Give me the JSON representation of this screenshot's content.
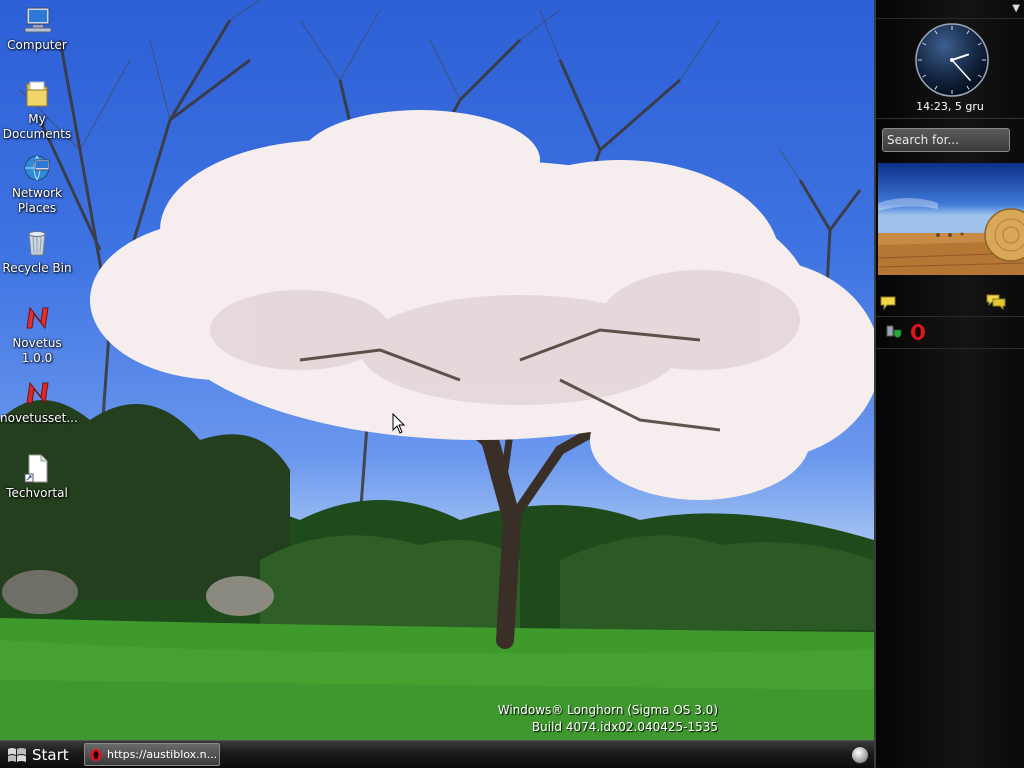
{
  "desktop": {
    "icons": [
      {
        "name": "computer-icon",
        "label": "Computer"
      },
      {
        "name": "my-documents-icon",
        "label": "My Documents"
      },
      {
        "name": "network-places-icon",
        "label": "Network Places"
      },
      {
        "name": "recycle-bin-icon",
        "label": "Recycle Bin"
      },
      {
        "name": "novetus-icon",
        "label": "Novetus 1.0.0"
      },
      {
        "name": "novetusset-icon",
        "label": "novetusset..."
      },
      {
        "name": "techvortal-icon",
        "label": "Techvortal"
      }
    ],
    "watermark": {
      "line1": "Windows® Longhorn (Sigma OS 3.0)",
      "line2": "Build 4074.idx02.040425-1535"
    }
  },
  "sidebar": {
    "clock": {
      "text": "14:23, 5 gru",
      "hour": 14,
      "minute": 23
    },
    "search": {
      "placeholder": "Search for..."
    },
    "slideshow": {
      "image": "hay-bale-field"
    },
    "feeds": {
      "icons": [
        "feed-bubble-icon",
        "feed-bubbles-icon"
      ]
    },
    "tray": {
      "icons": [
        "security-shield-icon",
        "opera-icon"
      ]
    }
  },
  "taskbar": {
    "start_label": "Start",
    "window_button": {
      "label": "https://austiblox.n...",
      "icon": "opera-icon"
    }
  },
  "colors": {
    "sky": "#3f74e2",
    "grass": "#3f9a2c",
    "blossom": "#f6eeee",
    "sidebar": "#0e0e0e",
    "taskbar": "#1b1b1b"
  }
}
